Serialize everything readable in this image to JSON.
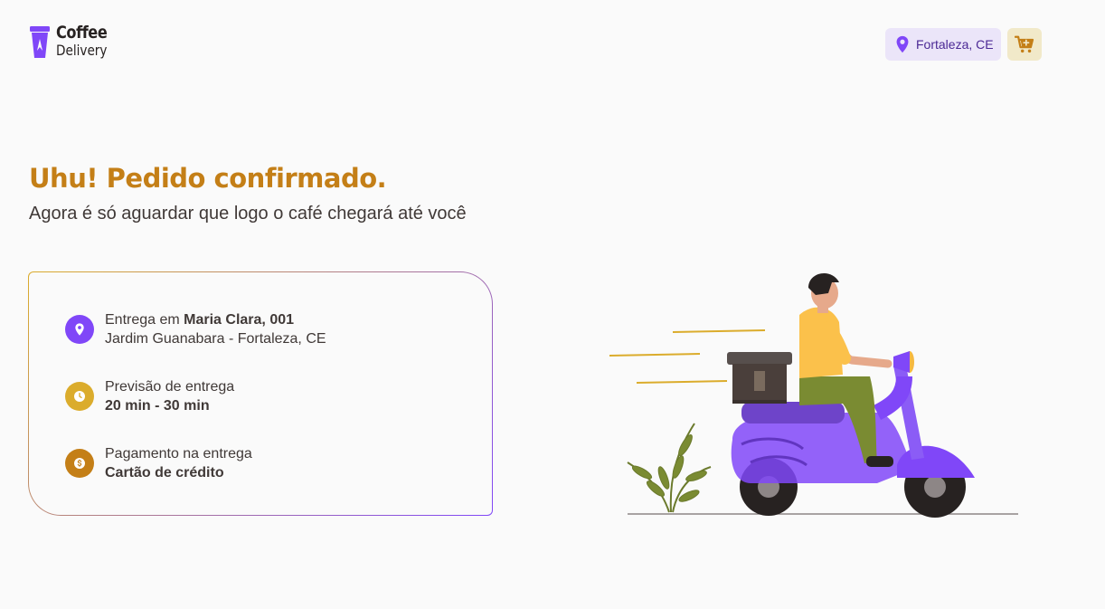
{
  "header": {
    "logo_line1": "Coffee",
    "logo_line2": "Delivery",
    "location": "Fortaleza, CE",
    "icons": {
      "location": "map-pin-icon",
      "cart": "shopping-cart-icon"
    }
  },
  "confirmation": {
    "title": "Uhu! Pedido confirmado.",
    "subtitle": "Agora é só aguardar que logo o café chegará até você"
  },
  "order_info": {
    "delivery": {
      "prefix": "Entrega em ",
      "address_bold": "Maria Clara, 001",
      "address_line2": "Jardim Guanabara - Fortaleza, CE",
      "icon": "map-pin-icon",
      "color": "#8047F8"
    },
    "forecast": {
      "label": "Previsão de entrega",
      "value": "20 min - 30 min",
      "icon": "timer-icon",
      "color": "#DBAC2C"
    },
    "payment": {
      "label": "Pagamento na entrega",
      "value": "Cartão de crédito",
      "icon": "currency-dollar-icon",
      "color": "#C47F17"
    }
  },
  "colors": {
    "primary_yellow": "#C47F17",
    "purple": "#8047F8",
    "purple_dark": "#4B2995",
    "purple_light": "#EBE5F9",
    "yellow_light": "#F1E9C9"
  }
}
